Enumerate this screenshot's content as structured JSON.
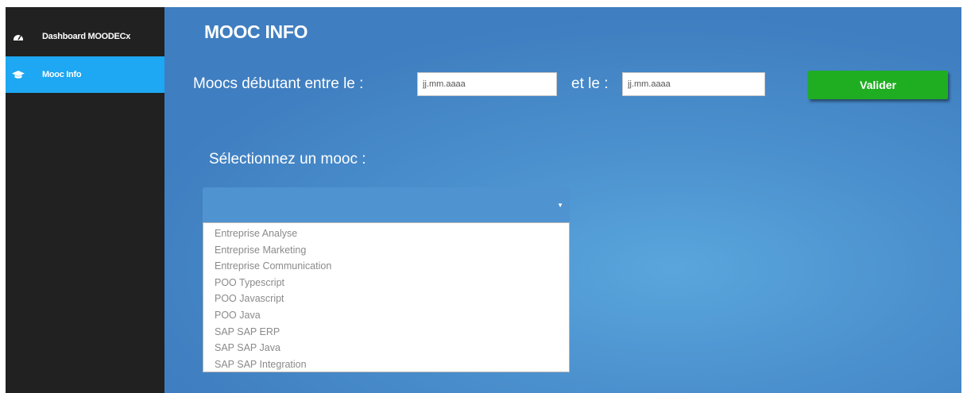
{
  "sidebar": {
    "items": [
      {
        "label": "Dashboard MOODECx",
        "icon": "dashboard-icon",
        "active": false
      },
      {
        "label": "Mooc Info",
        "icon": "graduation-cap-icon",
        "active": true
      }
    ]
  },
  "main": {
    "title": "MOOC INFO",
    "date_range": {
      "start_label": "Moocs débutant entre le :",
      "start_placeholder": "jj.mm.aaaa",
      "end_label": "et le :",
      "end_placeholder": "jj.mm.aaaa",
      "submit_label": "Valider"
    },
    "select_label": "Sélectionnez un mooc :",
    "select_value": "",
    "options": [
      "Entreprise Analyse",
      "Entreprise Marketing",
      "Entreprise Communication",
      "POO Typescript",
      "POO Javascript",
      "POO Java",
      "SAP SAP ERP",
      "SAP SAP Java",
      "SAP SAP Integration"
    ]
  },
  "colors": {
    "sidebar_bg": "#212121",
    "sidebar_active": "#1ea7f2",
    "main_bg": "#4a8fcc",
    "button_bg": "#1fae21"
  }
}
